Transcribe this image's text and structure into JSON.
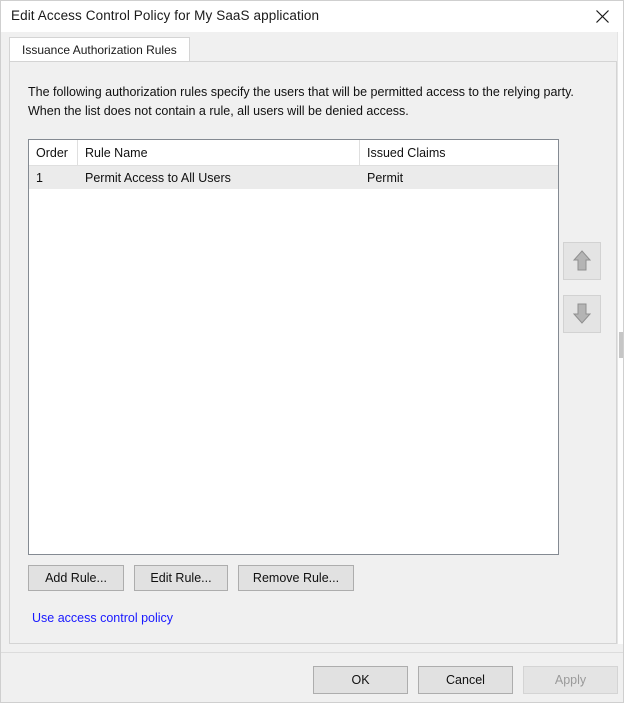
{
  "window": {
    "title": "Edit Access Control Policy for My SaaS application",
    "close_icon": "close-icon"
  },
  "tabs": [
    {
      "label": "Issuance Authorization Rules",
      "selected": true
    }
  ],
  "content": {
    "description": "The following authorization rules specify the users that will be permitted access to the relying party. When the list does not contain a rule, all users will be denied access."
  },
  "rules_table": {
    "columns": [
      "Order",
      "Rule Name",
      "Issued Claims"
    ],
    "rows": [
      {
        "order": "1",
        "rule_name": "Permit Access to All Users",
        "issued_claims": "Permit",
        "selected": true
      }
    ]
  },
  "reorder": {
    "move_up_icon": "arrow-up-icon",
    "move_down_icon": "arrow-down-icon",
    "enabled": false
  },
  "rule_actions": {
    "add": "Add Rule...",
    "edit": "Edit Rule...",
    "remove": "Remove Rule..."
  },
  "links": {
    "access_control_policy": "Use access control policy"
  },
  "footer": {
    "ok": "OK",
    "cancel": "Cancel",
    "apply": "Apply",
    "apply_enabled": false
  },
  "colors": {
    "dialog_background": "#f0f0f0",
    "titlebar_background": "#ffffff",
    "link": "#1818ff",
    "selected_row": "#ebebeb",
    "button_face": "#e1e1e1",
    "button_border": "#adadad",
    "disabled_text": "#9a9a9a",
    "list_border": "#848a92"
  }
}
